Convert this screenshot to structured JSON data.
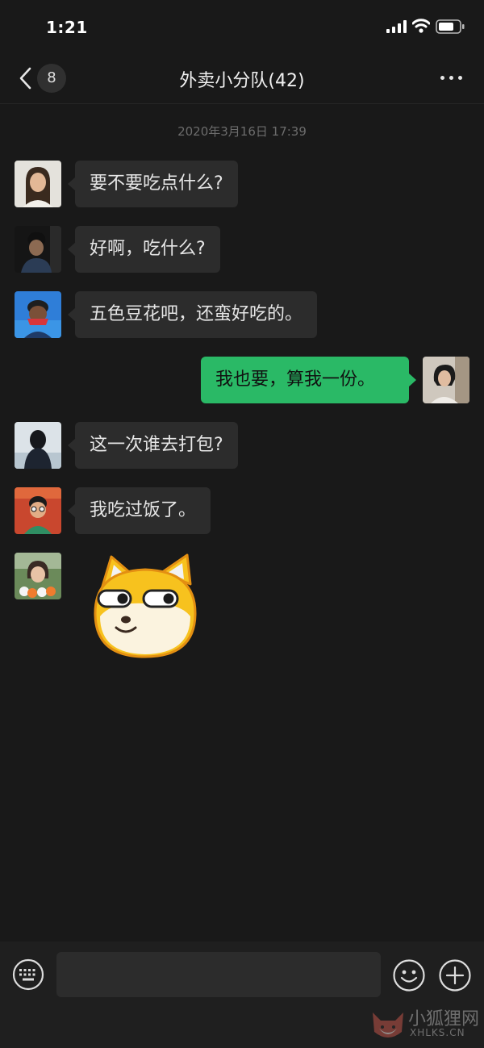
{
  "status_bar": {
    "time": "1:21",
    "signal_icon": "cellular-signal-icon",
    "wifi_icon": "wifi-icon",
    "battery_icon": "battery-icon"
  },
  "nav_bar": {
    "back_icon": "chevron-left-icon",
    "unread_count": "8",
    "title": "外卖小分队(42)",
    "more_icon": "ellipsis-icon"
  },
  "chat": {
    "timestamp": "2020年3月16日 17:39",
    "messages": [
      {
        "sender": "member",
        "text": "要不要吃点什么?"
      },
      {
        "sender": "member",
        "text": "好啊，吃什么?"
      },
      {
        "sender": "member",
        "text": "五色豆花吧，还蛮好吃的。"
      },
      {
        "sender": "self",
        "text": "我也要，算我一份。"
      },
      {
        "sender": "member",
        "text": "这一次谁去打包?"
      },
      {
        "sender": "member",
        "text": "我吃过饭了。"
      },
      {
        "sender": "member",
        "type": "sticker",
        "sticker": "shiba-dog-sticker"
      }
    ]
  },
  "input_bar": {
    "keyboard_icon": "keyboard-icon",
    "input_value": "",
    "emoji_icon": "smiley-icon",
    "add_icon": "plus-circle-icon"
  },
  "watermark": {
    "text_cn": "小狐狸网",
    "text_en": "XHLKS.CN"
  },
  "colors": {
    "background": "#191919",
    "bubble_incoming": "#2c2c2c",
    "bubble_outgoing": "#2ab966",
    "input_bar": "#1f1f1f"
  }
}
